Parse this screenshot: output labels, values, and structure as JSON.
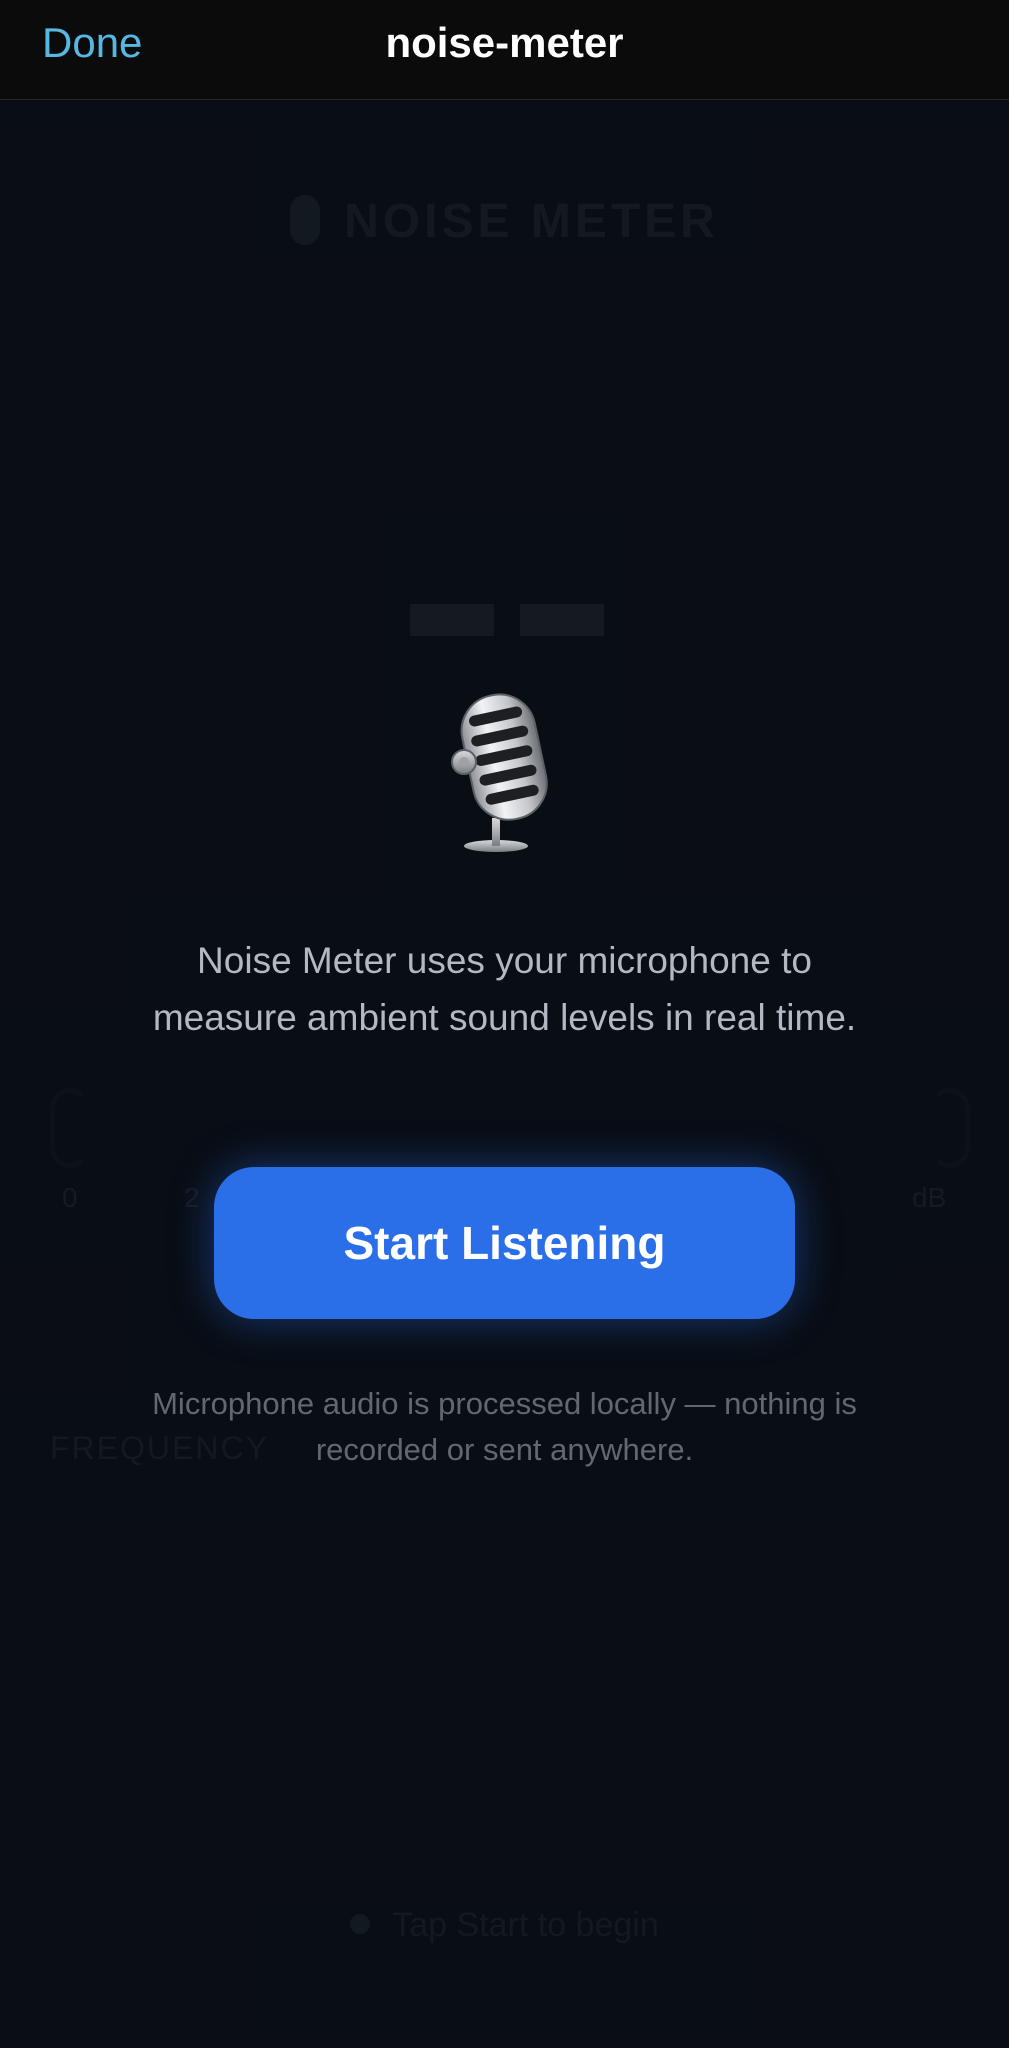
{
  "navbar": {
    "done_label": "Done",
    "title": "noise-meter"
  },
  "background": {
    "app_header": "NOISE METER",
    "scale_min": "0",
    "scale_mid": "2",
    "scale_unit": "dB",
    "section_label": "FREQUENCY",
    "status_text": "Tap Start to begin"
  },
  "overlay": {
    "icon": "studio-microphone-icon",
    "intro_text": "Noise Meter uses your microphone to measure ambient sound levels in real time.",
    "start_button_label": "Start Listening",
    "privacy_note": "Microphone audio is processed locally — nothing is recorded or sent anywhere."
  },
  "colors": {
    "background": "#0a0d14",
    "navbar": "#0b0b0c",
    "accent_link": "#58b7e0",
    "primary_button": "#2a6ee8",
    "body_text": "#b3b8c2",
    "muted_text": "#626872"
  }
}
